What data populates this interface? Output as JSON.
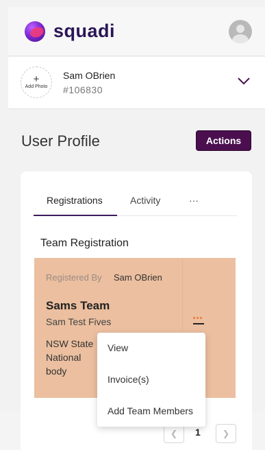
{
  "app": {
    "brand": "squadi",
    "colors": {
      "brand_purple": "#4b0f4f",
      "panel_bg": "#ebbf9f",
      "accent_orange": "#f07b3a"
    }
  },
  "header": {
    "logo_icon": "squadi-logo-icon",
    "account_icon": "user-avatar-icon"
  },
  "user": {
    "add_photo_plus": "+",
    "add_photo_label": "Add Photo",
    "name": "Sam OBrien",
    "id": "#106830",
    "expand_icon": "chevron-down-icon"
  },
  "profile": {
    "title": "User Profile",
    "actions_label": "Actions"
  },
  "tabs": [
    {
      "label": "Registrations",
      "active": true
    },
    {
      "label": "Activity",
      "active": false
    },
    {
      "label": "···",
      "active": false
    }
  ],
  "registration": {
    "section_title": "Team Registration",
    "registered_by_label": "Registered By",
    "registered_by_value": "Sam OBrien",
    "team_name": "Sams Team",
    "competition": "Sam Test Fives",
    "organisation": "NSW State National body",
    "more_icon": "more-options-icon"
  },
  "menu": {
    "items": [
      "View",
      "Invoice(s)",
      "Add Team Members"
    ]
  },
  "pagination": {
    "prev_icon": "chevron-left-icon",
    "current_page": "1",
    "next_icon": "chevron-right-icon"
  }
}
